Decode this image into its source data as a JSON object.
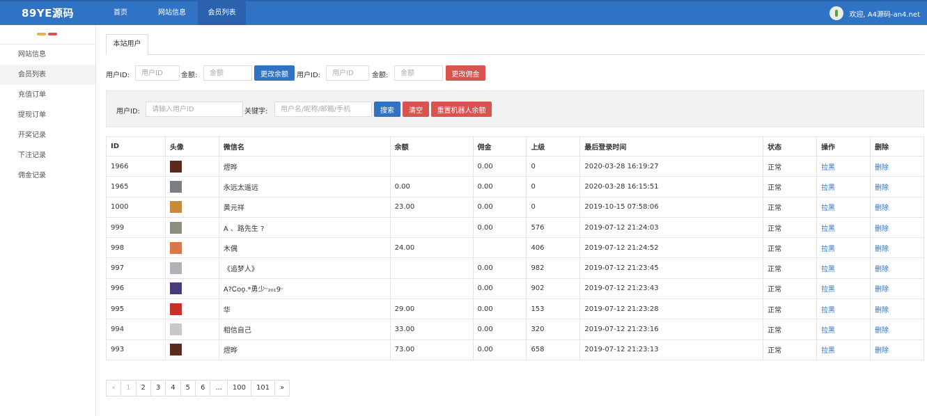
{
  "header": {
    "brand": "89YE源码",
    "nav": [
      {
        "label": "首页"
      },
      {
        "label": "网站信息"
      },
      {
        "label": "会员列表"
      }
    ],
    "welcome": "欢迎, A4源码-an4.net"
  },
  "sidebar": {
    "items": [
      {
        "label": "网站信息"
      },
      {
        "label": "会员列表"
      },
      {
        "label": "充值订单"
      },
      {
        "label": "提现订单"
      },
      {
        "label": "开奖记录"
      },
      {
        "label": "下注记录"
      },
      {
        "label": "佣金记录"
      }
    ]
  },
  "tab": {
    "label": "本站用户"
  },
  "balance_form": {
    "user_id_label": "用户ID:",
    "user_id_placeholder": "用户ID",
    "amount_label": "金额:",
    "amount_placeholder": "金额",
    "balance_button": "更改余额",
    "commission_button": "更改佣金"
  },
  "search": {
    "user_id_label": "用户ID:",
    "user_id_placeholder": "请输入用户ID",
    "keyword_label": "关键字:",
    "keyword_placeholder": "用户名/昵称/邮箱/手机",
    "search_button": "搜索",
    "clear_button": "清空",
    "reset_robot_button": "重置机器人余额"
  },
  "table": {
    "headers": [
      "ID",
      "头像",
      "微信名",
      "余额",
      "佣金",
      "上级",
      "最后登录时间",
      "状态",
      "操作",
      "删除"
    ],
    "rows": [
      {
        "id": "1966",
        "name": "熤晔",
        "balance": "",
        "commission": "0.00",
        "parent": "0",
        "last_login": "2020-03-28 16:19:27",
        "status": "正常",
        "action": "拉黑",
        "delete": "删除",
        "avatar_color": "#5a2a1e"
      },
      {
        "id": "1965",
        "name": "永远太遥远",
        "balance": "0.00",
        "commission": "0.00",
        "parent": "0",
        "last_login": "2020-03-28 16:15:51",
        "status": "正常",
        "action": "拉黑",
        "delete": "删除",
        "avatar_color": "#7a7f86"
      },
      {
        "id": "1000",
        "name": "黄元祥",
        "balance": "23.00",
        "commission": "0.00",
        "parent": "0",
        "last_login": "2019-10-15 07:58:06",
        "status": "正常",
        "action": "拉黑",
        "delete": "删除",
        "avatar_color": "#c98a3a"
      },
      {
        "id": "999",
        "name": "A 、路先生 ?",
        "balance": "",
        "commission": "0.00",
        "parent": "576",
        "last_login": "2019-07-12 21:24:03",
        "status": "正常",
        "action": "拉黑",
        "delete": "删除",
        "avatar_color": "#8a8f80"
      },
      {
        "id": "998",
        "name": "木偶",
        "balance": "24.00",
        "commission": "",
        "parent": "406",
        "last_login": "2019-07-12 21:24:52",
        "status": "正常",
        "action": "拉黑",
        "delete": "删除",
        "avatar_color": "#d9764a"
      },
      {
        "id": "997",
        "name": "《追梦人》",
        "balance": "",
        "commission": "0.00",
        "parent": "982",
        "last_login": "2019-07-12 21:23:45",
        "status": "正常",
        "action": "拉黑",
        "delete": "删除",
        "avatar_color": "#b5b0b8"
      },
      {
        "id": "996",
        "name": "A?Ꮯᴏǫ.*勇少ᵕ₂₀₁9ᵕ",
        "balance": "",
        "commission": "0.00",
        "parent": "902",
        "last_login": "2019-07-12 21:23:43",
        "status": "正常",
        "action": "拉黑",
        "delete": "删除",
        "avatar_color": "#4a3a7a"
      },
      {
        "id": "995",
        "name": "华",
        "balance": "29.00",
        "commission": "0.00",
        "parent": "153",
        "last_login": "2019-07-12 21:23:28",
        "status": "正常",
        "action": "拉黑",
        "delete": "删除",
        "avatar_color": "#c4312b"
      },
      {
        "id": "994",
        "name": "相信自己",
        "balance": "33.00",
        "commission": "0.00",
        "parent": "320",
        "last_login": "2019-07-12 21:23:16",
        "status": "正常",
        "action": "拉黑",
        "delete": "删除",
        "avatar_color": "#c8c8c8"
      },
      {
        "id": "993",
        "name": "熤晔",
        "balance": "73.00",
        "commission": "0.00",
        "parent": "658",
        "last_login": "2019-07-12 21:23:13",
        "status": "正常",
        "action": "拉黑",
        "delete": "删除",
        "avatar_color": "#5a2a1e"
      }
    ]
  },
  "pagination": {
    "pages": [
      "«",
      "1",
      "2",
      "3",
      "4",
      "5",
      "6",
      "...",
      "100",
      "101",
      "»"
    ]
  }
}
